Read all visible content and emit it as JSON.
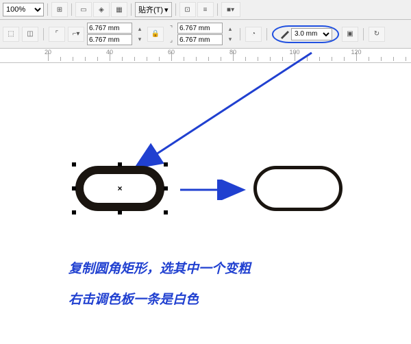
{
  "toolbar": {
    "zoom": "100%",
    "align_label": "贴齐(T)",
    "corner_radius1_x": "6.767 mm",
    "corner_radius1_y": "6.767 mm",
    "corner_radius2_x": "6.767 mm",
    "corner_radius2_y": "6.767 mm",
    "outline_width": "3.0 mm"
  },
  "ruler_ticks": [
    {
      "pos": 70,
      "label": "20"
    },
    {
      "pos": 160,
      "label": "40"
    },
    {
      "pos": 250,
      "label": "60"
    },
    {
      "pos": 340,
      "label": "80"
    },
    {
      "pos": 430,
      "label": "100"
    },
    {
      "pos": 520,
      "label": "120"
    }
  ],
  "center_mark": "×",
  "instructions": {
    "line1": "复制圆角矩形，选其中一个变粗",
    "line2": "右击调色板一条是白色"
  },
  "annotation_color": "#2040d0"
}
